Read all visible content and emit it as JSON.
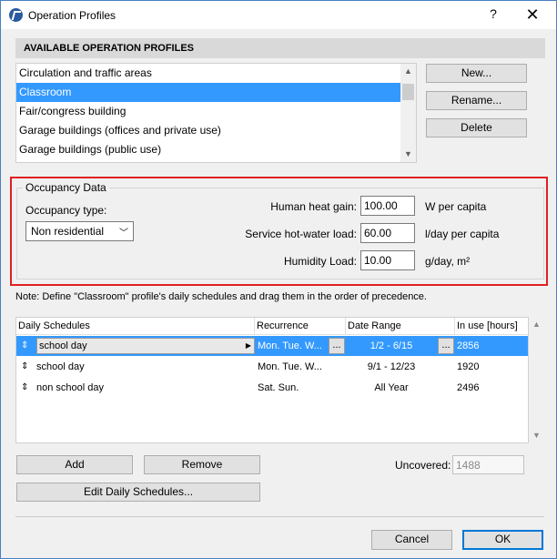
{
  "window": {
    "title": "Operation Profiles",
    "help": "?",
    "close": "✕"
  },
  "profiles": {
    "header": "AVAILABLE OPERATION PROFILES",
    "items": [
      {
        "label": "Circulation and traffic areas"
      },
      {
        "label": "Classroom"
      },
      {
        "label": "Fair/congress building"
      },
      {
        "label": "Garage buildings (offices and private use)"
      },
      {
        "label": "Garage buildings (public use)"
      }
    ],
    "selected_index": 1,
    "buttons": {
      "new": "New...",
      "rename": "Rename...",
      "delete": "Delete"
    }
  },
  "occupancy": {
    "group_title": "Occupancy Data",
    "type_label": "Occupancy type:",
    "type_value": "Non residential",
    "heat_gain_label": "Human heat gain:",
    "heat_gain_value": "100.00",
    "heat_gain_unit": "W per capita",
    "hot_water_label": "Service hot-water load:",
    "hot_water_value": "60.00",
    "hot_water_unit": "l/day per capita",
    "humidity_label": "Humidity Load:",
    "humidity_value": "10.00",
    "humidity_unit": "g/day, m²"
  },
  "note": "Note: Define \"Classroom\" profile's daily schedules and drag them in the order of precedence.",
  "schedules": {
    "headers": {
      "name": "Daily Schedules",
      "recurrence": "Recurrence",
      "date_range": "Date Range",
      "in_use": "In use [hours]"
    },
    "rows": [
      {
        "name": "school day",
        "recurrence": "Mon. Tue. W...",
        "date_range": "1/2 - 6/15",
        "in_use": "2856"
      },
      {
        "name": "school day",
        "recurrence": "Mon. Tue. W...",
        "date_range": "9/1 - 12/23",
        "in_use": "1920"
      },
      {
        "name": "non school day",
        "recurrence": "Sat. Sun.",
        "date_range": "All Year",
        "in_use": "2496"
      }
    ],
    "dots": "...",
    "handle": "⇕"
  },
  "actions": {
    "add": "Add",
    "remove": "Remove",
    "edit": "Edit Daily Schedules...",
    "uncovered_label": "Uncovered:",
    "uncovered_value": "1488",
    "cancel": "Cancel",
    "ok": "OK"
  },
  "colors": {
    "selection": "#3399ff",
    "highlight_frame": "#e02020",
    "accent": "#0078d7"
  }
}
